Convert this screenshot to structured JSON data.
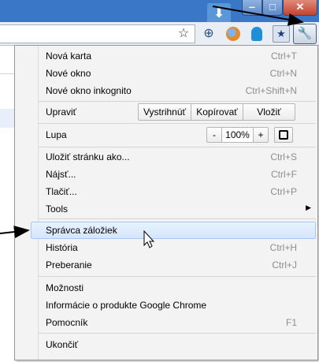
{
  "window": {
    "minimize_glyph": "‒",
    "maximize_glyph": "□",
    "close_glyph": "✕"
  },
  "toolbar": {
    "icons": [
      "download-icon",
      "star-icon",
      "globe-icon",
      "firefox-like-icon",
      "ghost-icon",
      "bookmark-extension-icon",
      "wrench-icon"
    ],
    "star_glyph": "☆",
    "globe_glyph": "⊕",
    "ext_glyph": "★",
    "wrench_glyph": "🔧",
    "download_glyph": "⬇"
  },
  "menu": {
    "new_tab": {
      "label": "Nová karta",
      "shortcut": "Ctrl+T"
    },
    "new_window": {
      "label": "Nové okno",
      "shortcut": "Ctrl+N"
    },
    "new_incognito": {
      "label": "Nové okno inkognito",
      "shortcut": "Ctrl+Shift+N"
    },
    "edit": {
      "label": "Upraviť",
      "cut": "Vystrihnúť",
      "copy": "Kopírovať",
      "paste": "Vložiť"
    },
    "zoom": {
      "label": "Lupa",
      "minus": "-",
      "value": "100%",
      "plus": "+"
    },
    "save_page": {
      "label": "Uložiť stránku ako...",
      "shortcut": "Ctrl+S"
    },
    "find": {
      "label": "Nájsť...",
      "shortcut": "Ctrl+F"
    },
    "print": {
      "label": "Tlačiť...",
      "shortcut": "Ctrl+P"
    },
    "tools": {
      "label": "Tools",
      "arrow": "▶"
    },
    "bookmark_manager": {
      "label": "Správca záložiek"
    },
    "history": {
      "label": "História",
      "shortcut": "Ctrl+H"
    },
    "downloads": {
      "label": "Preberanie",
      "shortcut": "Ctrl+J"
    },
    "options": {
      "label": "Možnosti"
    },
    "about": {
      "label": "Informácie o produkte Google Chrome"
    },
    "help": {
      "label": "Pomocník",
      "shortcut": "F1"
    },
    "exit": {
      "label": "Ukončiť"
    }
  }
}
